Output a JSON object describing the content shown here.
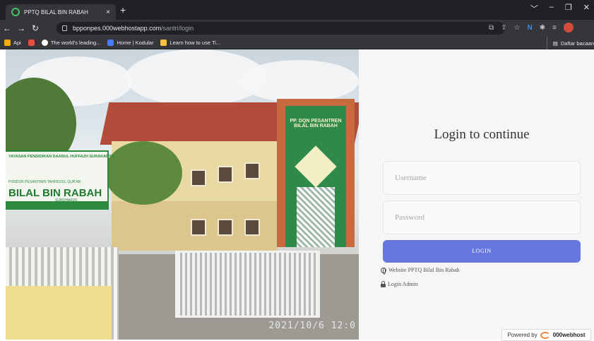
{
  "browser": {
    "tab_title": "PPTQ BILAL BIN RABAH",
    "tab_close": "×",
    "new_tab": "+",
    "window_controls": [
      "﹀",
      "–",
      "❐",
      "✕"
    ],
    "url_host": "bpponpes.000webhostapp.com",
    "url_path": "/santri/login",
    "bookmarks": [
      {
        "label": "Api",
        "icon": "apps-grid-icon",
        "color": "#f9ab00"
      },
      {
        "label": "",
        "icon": "red-square-icon",
        "color": "#e84c3d"
      },
      {
        "label": "The world's leading...",
        "icon": "github-icon",
        "color": "#ffffff"
      },
      {
        "label": "Home | Kodular",
        "icon": "kodular-icon",
        "color": "#4a7cf7"
      },
      {
        "label": "Learn how to use Ti...",
        "icon": "tiles-icon",
        "color": "#f6c33b"
      }
    ],
    "reading_list": "Daftar bacaan"
  },
  "photo": {
    "tower_text": "PP. DQN PESANTREN BILAL BIN RABAH",
    "sign_top": "YAYASAN PENDIDIKAN DAARUL HUFFAZH SURAKARTA",
    "sign_mid": "PONDOK PESANTREN TAHFIDZUL QUR'AN",
    "sign_name": "BILAL BIN RABAH",
    "sign_city": "SUROHARJO",
    "timestamp": "2021/10/6 12:0"
  },
  "login": {
    "title": "Login to continue",
    "username_placeholder": "Username",
    "password_placeholder": "Password",
    "button_label": "LOGIN",
    "link_website": "Website PPTQ Bilal Bin Rabah",
    "link_admin": "Login Admin"
  },
  "footer": {
    "powered_by": "Powered by",
    "brand": "000webhost"
  },
  "colors": {
    "accent": "#6777e0",
    "chrome_dark": "#202124",
    "chrome_mid": "#35363a"
  }
}
